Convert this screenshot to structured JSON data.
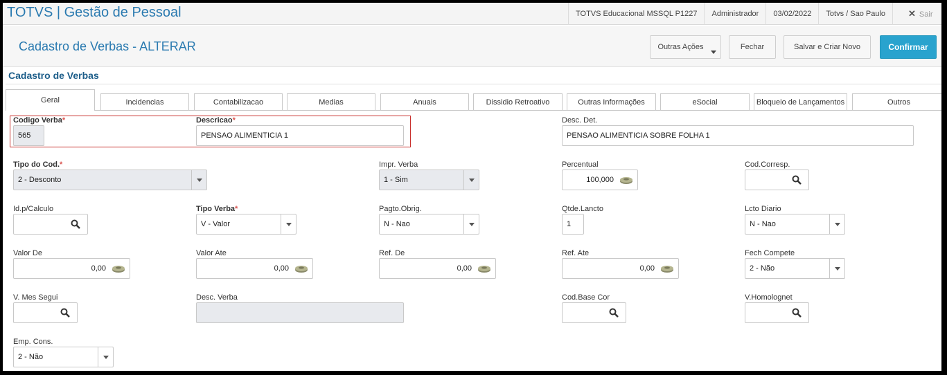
{
  "topbar": {
    "app_title": "TOTVS | Gestão de Pessoal",
    "environment": "TOTVS Educacional MSSQL P1227",
    "user": "Administrador",
    "date": "03/02/2022",
    "branch": "Totvs / Sao Paulo",
    "exit_label": "Sair"
  },
  "header": {
    "page_title": "Cadastro de Verbas - ALTERAR",
    "buttons": {
      "other_actions": "Outras Ações",
      "close": "Fechar",
      "save_new": "Salvar e Criar Novo",
      "confirm": "Confirmar"
    }
  },
  "section_title": "Cadastro de Verbas",
  "tabs": [
    "Geral",
    "Incidencias",
    "Contabilizacao",
    "Medias",
    "Anuais",
    "Dissidio Retroativo",
    "Outras Informações",
    "eSocial",
    "Bloqueio de Lançamentos",
    "Outros"
  ],
  "active_tab": "Geral",
  "required_mark": "*",
  "fields": {
    "codigo_verba": {
      "label": "Codigo Verba",
      "value": "565"
    },
    "descricao": {
      "label": "Descricao",
      "value": "PENSAO ALIMENTICIA 1"
    },
    "desc_det": {
      "label": "Desc. Det.",
      "value": "PENSAO ALIMENTICIA SOBRE FOLHA 1"
    },
    "tipo_cod": {
      "label": "Tipo do Cod.",
      "value": "2 - Desconto"
    },
    "impr_verba": {
      "label": "Impr. Verba",
      "value": "1 - Sim"
    },
    "percentual": {
      "label": "Percentual",
      "value": "100,000"
    },
    "cod_corresp": {
      "label": "Cod.Corresp.",
      "value": ""
    },
    "id_calculo": {
      "label": "Id.p/Calculo",
      "value": ""
    },
    "tipo_verba": {
      "label": "Tipo Verba",
      "value": "V - Valor"
    },
    "pagto_obrig": {
      "label": "Pagto.Obrig.",
      "value": "N - Nao"
    },
    "qtde_lancto": {
      "label": "Qtde.Lancto",
      "value": "1"
    },
    "lcto_diario": {
      "label": "Lcto Diario",
      "value": "N - Nao"
    },
    "valor_de": {
      "label": "Valor De",
      "value": "0,00"
    },
    "valor_ate": {
      "label": "Valor Ate",
      "value": "0,00"
    },
    "ref_de": {
      "label": "Ref. De",
      "value": "0,00"
    },
    "ref_ate": {
      "label": "Ref. Ate",
      "value": "0,00"
    },
    "fech_compete": {
      "label": "Fech Compete",
      "value": "2 - Não"
    },
    "v_mes_segui": {
      "label": "V. Mes Segui",
      "value": ""
    },
    "desc_verba": {
      "label": "Desc. Verba",
      "value": ""
    },
    "cod_base_cor": {
      "label": "Cod.Base Cor",
      "value": ""
    },
    "v_homolognet": {
      "label": "V.Homolognet",
      "value": ""
    },
    "emp_cons": {
      "label": "Emp. Cons.",
      "value": "2 - Não"
    }
  },
  "colors": {
    "brand_blue": "#2a7ab0",
    "confirm_button": "#29a3ce",
    "required_red": "#d9534f",
    "readonly_field": "#e8eaee"
  }
}
